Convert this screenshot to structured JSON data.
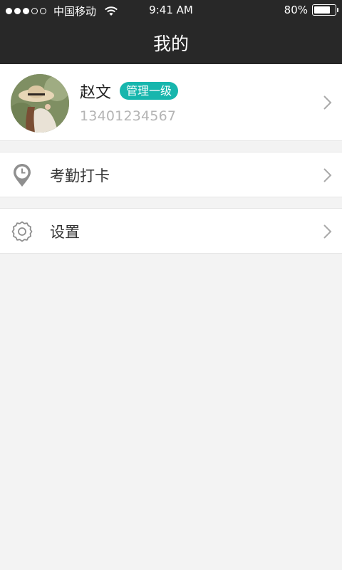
{
  "status_bar": {
    "carrier": "中国移动",
    "time": "9:41 AM",
    "battery_text": "80%",
    "battery_level": 0.8,
    "signal_dots_filled": 3,
    "signal_dots_total": 5
  },
  "nav": {
    "title": "我的"
  },
  "profile": {
    "name": "赵文",
    "role_badge": "管理一级",
    "phone": "13401234567",
    "badge_color": "#17b6ad"
  },
  "menu": {
    "items": [
      {
        "label": "考勤打卡",
        "icon": "location-clock-icon"
      },
      {
        "label": "设置",
        "icon": "gear-icon"
      }
    ]
  },
  "colors": {
    "header_bg": "#282828",
    "page_bg": "#f3f3f3",
    "accent": "#17b6ad"
  }
}
